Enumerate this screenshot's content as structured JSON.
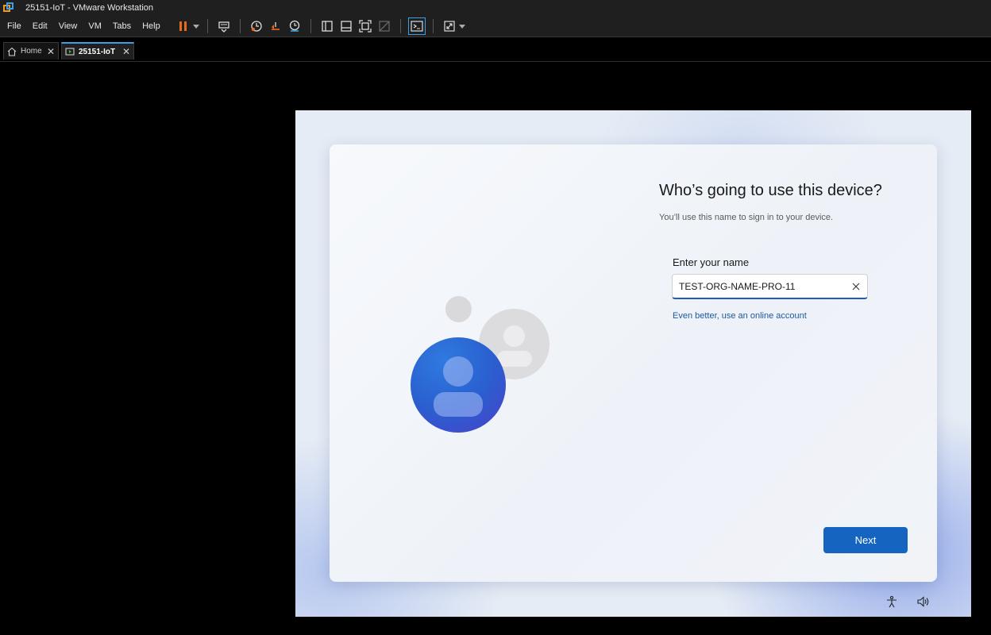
{
  "window": {
    "title": "25151-IoT - VMware Workstation"
  },
  "menu": {
    "items": [
      {
        "label": "File"
      },
      {
        "label": "Edit"
      },
      {
        "label": "View"
      },
      {
        "label": "VM"
      },
      {
        "label": "Tabs"
      },
      {
        "label": "Help"
      }
    ]
  },
  "toolbar": {
    "icons": [
      "pause-icon",
      "send-ctrl-alt-del-icon",
      "snapshot-icon",
      "revert-snapshot-icon",
      "snapshot-manager-icon",
      "library-view-icon",
      "thumbnail-bar-icon",
      "fullscreen-icon",
      "unity-icon",
      "console-view-icon",
      "stretch-view-icon"
    ],
    "accent": "#e86a1a"
  },
  "tabs": [
    {
      "label": "Home"
    },
    {
      "label": "25151-IoT"
    }
  ],
  "oobe": {
    "title": "Who’s going to use this device?",
    "subtitle": "You’ll use this name to sign in to your device.",
    "field_label": "Enter your name",
    "name_value": "TEST-ORG-NAME-PRO-11",
    "online_account_link": "Even better, use an online account",
    "next_label": "Next",
    "accent": "#1565c0"
  },
  "tray": {
    "icons": [
      "accessibility-icon",
      "volume-icon"
    ]
  }
}
